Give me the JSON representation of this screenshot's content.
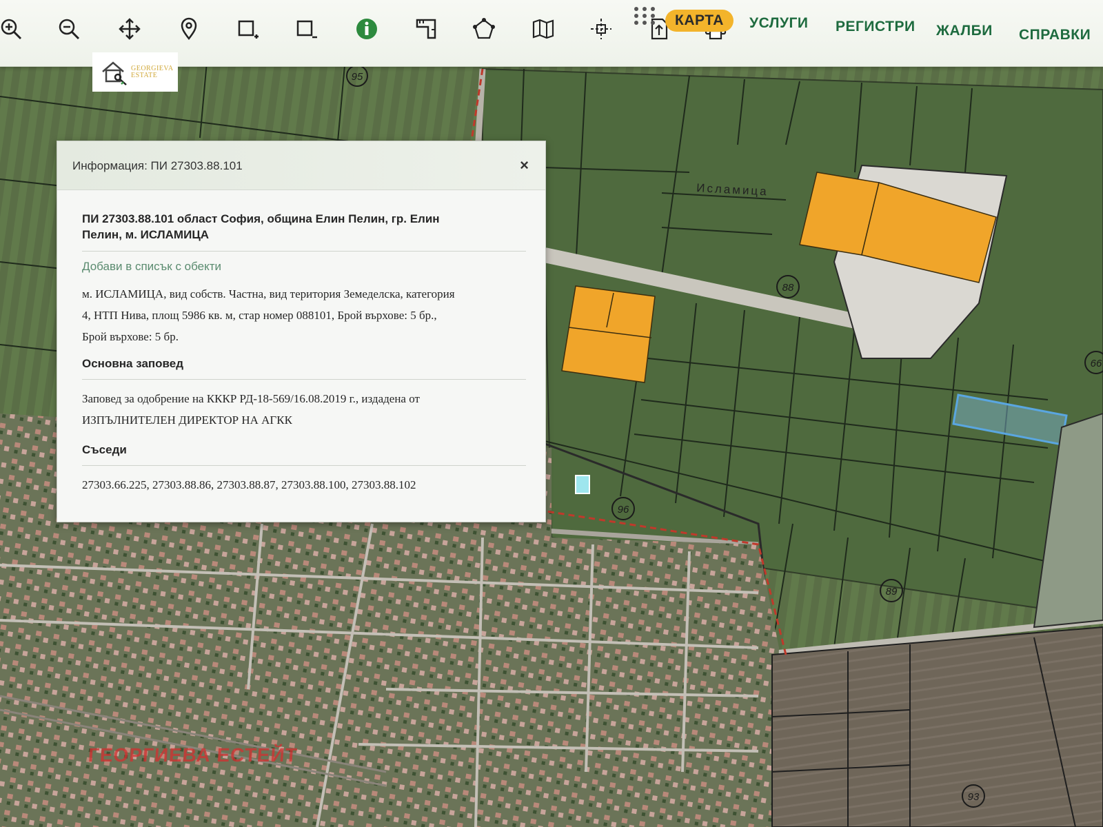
{
  "toolbar": {
    "tools": [
      {
        "name": "zoom-in-icon"
      },
      {
        "name": "zoom-out-icon"
      },
      {
        "name": "pan-icon"
      },
      {
        "name": "location-pin-icon"
      },
      {
        "name": "select-area-icon"
      },
      {
        "name": "deselect-area-icon"
      },
      {
        "name": "info-icon",
        "active": true
      },
      {
        "name": "measure-icon"
      },
      {
        "name": "polygon-icon"
      },
      {
        "name": "layers-map-icon"
      },
      {
        "name": "coordinates-icon"
      },
      {
        "name": "upload-icon"
      },
      {
        "name": "print-icon"
      }
    ],
    "nav": {
      "map": "КАРТА",
      "services": "УСЛУГИ",
      "registers": "РЕГИСТРИ",
      "complaints": "ЖАЛБИ",
      "references": "СПРАВКИ"
    },
    "active_color": "#f3b42b",
    "nav_color": "#1e6b3f"
  },
  "logo": {
    "line1": "GEORGIEVA",
    "line2": "ESTATE"
  },
  "popup": {
    "title": "Информация: ПИ 27303.88.101",
    "close": "×",
    "heading_line1": "ПИ 27303.88.101 област София, община Елин Пелин, гр. Елин",
    "heading_line2": "Пелин, м. ИСЛАМИЦА",
    "add_link": "Добави в списък с обекти",
    "description_line1": "м. ИСЛАМИЦА, вид собств. Частна, вид територия Земеделска, категория",
    "description_line2": "4, НТП Нива, площ 5986 кв. м, стар номер 088101, Брой върхове: 5 бр.,",
    "description_line3": "Брой върхове: 5 бр.",
    "order_heading": "Основна заповед",
    "order_line1": "Заповед за одобрение на КККР РД-18-569/16.08.2019 г., издадена от",
    "order_line2": "ИЗПЪЛНИТЕЛЕН ДИРЕКТОР НА АГКК",
    "neighbors_heading": "Съседи",
    "neighbors": "27303.66.225, 27303.88.86, 27303.88.87, 27303.88.100, 27303.88.102"
  },
  "map": {
    "locality_label": "Исламица",
    "block_numbers": [
      "95",
      "88",
      "96",
      "89",
      "93",
      "66"
    ],
    "highlight_color": "#5aa6e0",
    "building_color": "#f0a52a"
  },
  "watermark": "ГЕОРГИЕВА ЕСТЕЙТ"
}
